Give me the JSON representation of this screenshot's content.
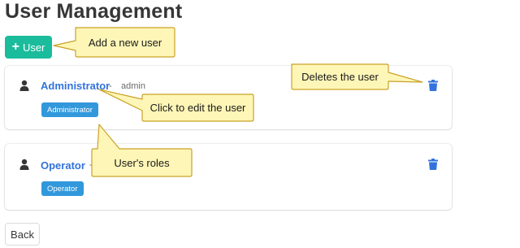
{
  "page": {
    "title": "User Management"
  },
  "toolbar": {
    "add_label": "User",
    "add_icon": "plus-icon"
  },
  "users": [
    {
      "display_name": "Administrator",
      "separator": "-",
      "username": "admin",
      "roles": [
        "Administrator"
      ],
      "icon": "user-icon",
      "delete_icon": "trash-icon"
    },
    {
      "display_name": "Operator",
      "separator": "-",
      "username": "",
      "roles": [
        "Operator"
      ],
      "icon": "user-icon",
      "delete_icon": "trash-icon"
    }
  ],
  "footer": {
    "back_label": "Back"
  },
  "annotations": {
    "add_user": "Add a new user",
    "delete_user": "Deletes the user",
    "edit_user": "Click to edit the user",
    "roles": "User's roles"
  },
  "colors": {
    "primary": "#1abc9c",
    "link": "#3273dc",
    "tag": "#3298dc",
    "callout_fill": "#fef6b7",
    "callout_border": "#c9a227"
  }
}
